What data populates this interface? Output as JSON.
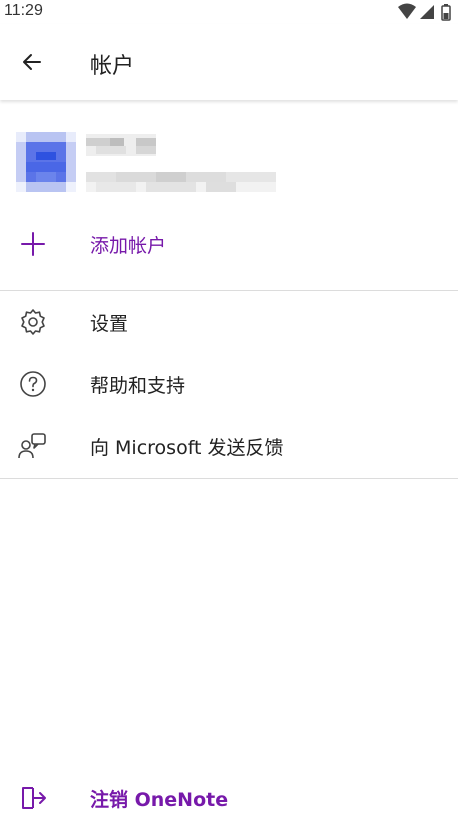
{
  "status_bar": {
    "time": "11:29"
  },
  "header": {
    "title": "帐户",
    "back_icon": "arrow-left-icon"
  },
  "account": {
    "add_account_label": "添加帐户"
  },
  "menu": {
    "settings_label": "设置",
    "help_label": "帮助和支持",
    "feedback_label": "向 Microsoft 发送反馈"
  },
  "footer": {
    "sign_out_label": "注销 OneNote"
  },
  "colors": {
    "accent": "#7719aa",
    "avatar_blue": "#4a67e6",
    "divider": "#dcdcdc"
  }
}
